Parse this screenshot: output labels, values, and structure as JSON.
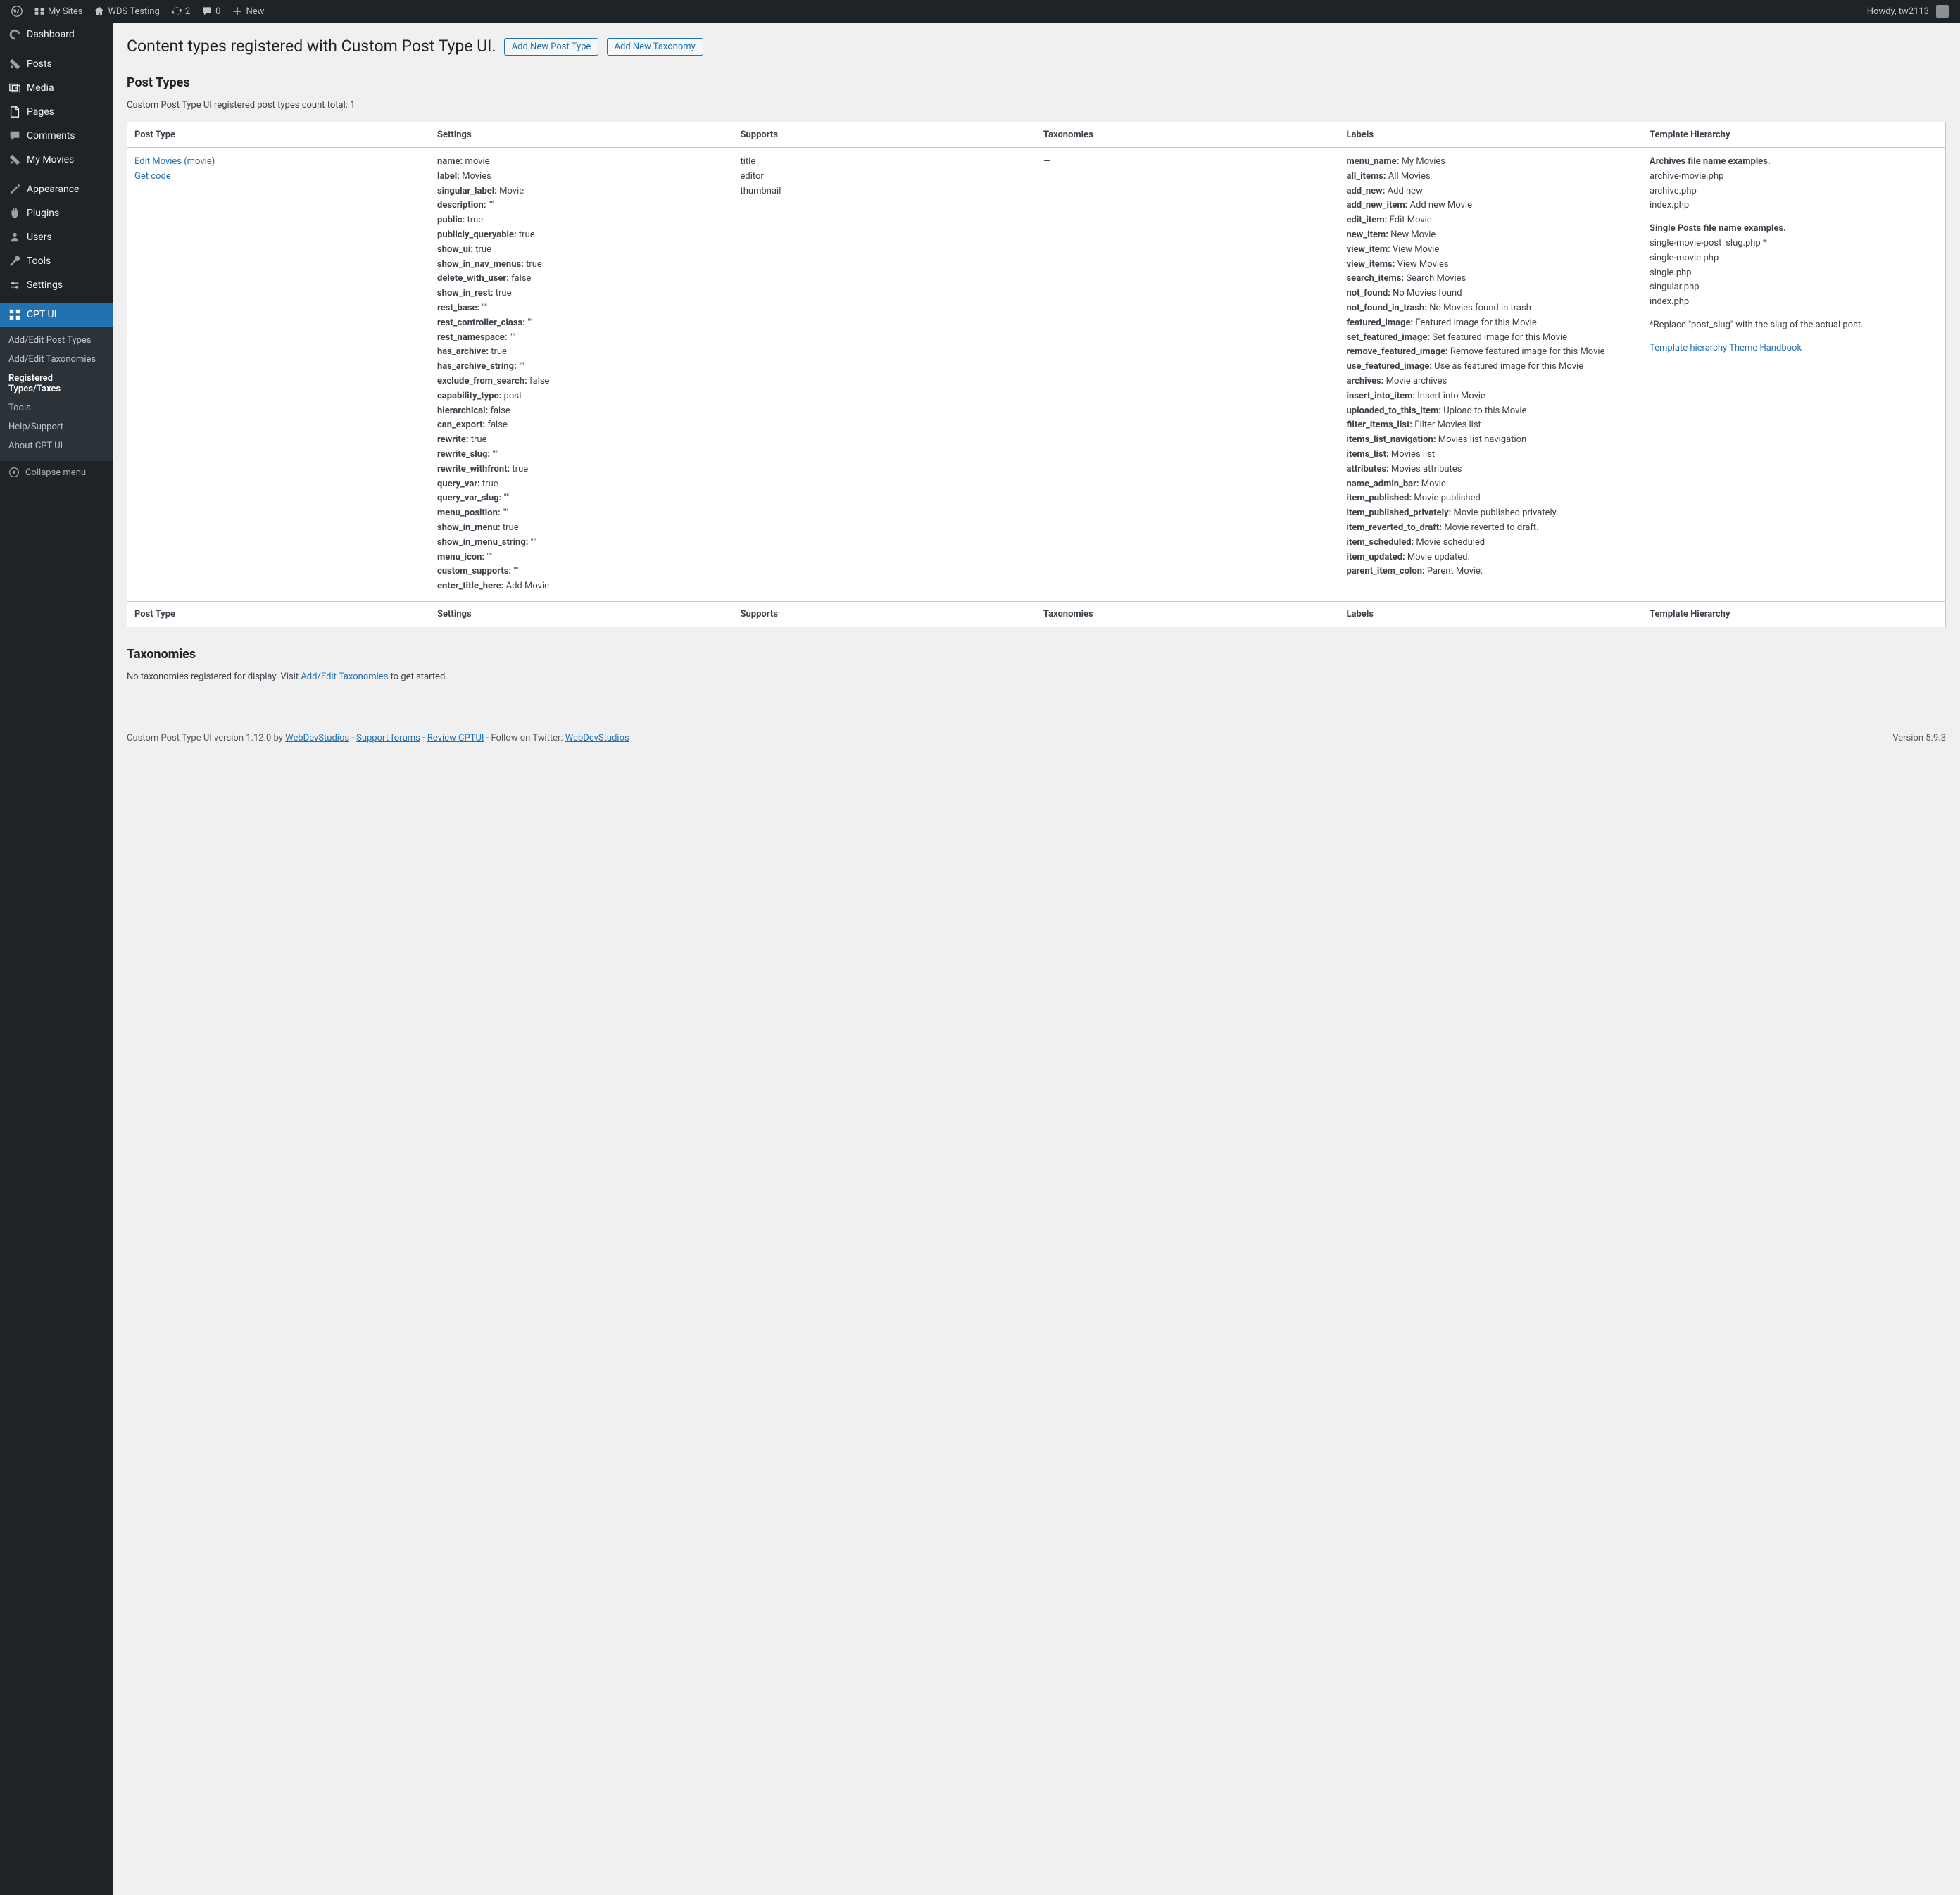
{
  "adminbar": {
    "my_sites": "My Sites",
    "site_name": "WDS Testing",
    "updates_count": "2",
    "comments_count": "0",
    "new": "New",
    "howdy": "Howdy, tw2113"
  },
  "sidebar": {
    "dashboard": "Dashboard",
    "posts": "Posts",
    "media": "Media",
    "pages": "Pages",
    "comments": "Comments",
    "my_movies": "My Movies",
    "appearance": "Appearance",
    "plugins": "Plugins",
    "users": "Users",
    "tools": "Tools",
    "settings": "Settings",
    "cpt_ui": "CPT UI",
    "sub": {
      "add_edit_post_types": "Add/Edit Post Types",
      "add_edit_taxonomies": "Add/Edit Taxonomies",
      "registered_types_taxes": "Registered Types/Taxes",
      "tools": "Tools",
      "help_support": "Help/Support",
      "about_cpt_ui": "About CPT UI"
    },
    "collapse": "Collapse menu"
  },
  "page": {
    "title": "Content types registered with Custom Post Type UI.",
    "add_post_type": "Add New Post Type",
    "add_taxonomy": "Add New Taxonomy",
    "post_types_heading": "Post Types",
    "count_text": "Custom Post Type UI registered post types count total: 1",
    "taxonomies_heading": "Taxonomies",
    "no_tax_prefix": "No taxonomies registered for display. Visit ",
    "no_tax_link": "Add/Edit Taxonomies",
    "no_tax_suffix": " to get started."
  },
  "table": {
    "columns": {
      "post_type": "Post Type",
      "settings": "Settings",
      "supports": "Supports",
      "taxonomies": "Taxonomies",
      "labels": "Labels",
      "template_hierarchy": "Template Hierarchy"
    },
    "row": {
      "edit_link": "Edit Movies (movie)",
      "get_code": "Get code",
      "taxonomies": "—",
      "supports": [
        "title",
        "editor",
        "thumbnail"
      ],
      "settings": [
        {
          "k": "name",
          "v": "movie"
        },
        {
          "k": "label",
          "v": "Movies"
        },
        {
          "k": "singular_label",
          "v": "Movie"
        },
        {
          "k": "description",
          "v": "\"\""
        },
        {
          "k": "public",
          "v": "true"
        },
        {
          "k": "publicly_queryable",
          "v": "true"
        },
        {
          "k": "show_ui",
          "v": "true"
        },
        {
          "k": "show_in_nav_menus",
          "v": "true"
        },
        {
          "k": "delete_with_user",
          "v": "false"
        },
        {
          "k": "show_in_rest",
          "v": "true"
        },
        {
          "k": "rest_base",
          "v": "\"\""
        },
        {
          "k": "rest_controller_class",
          "v": "\"\""
        },
        {
          "k": "rest_namespace",
          "v": "\"\""
        },
        {
          "k": "has_archive",
          "v": "true"
        },
        {
          "k": "has_archive_string",
          "v": "\"\""
        },
        {
          "k": "exclude_from_search",
          "v": "false"
        },
        {
          "k": "capability_type",
          "v": "post"
        },
        {
          "k": "hierarchical",
          "v": "false"
        },
        {
          "k": "can_export",
          "v": "false"
        },
        {
          "k": "rewrite",
          "v": "true"
        },
        {
          "k": "rewrite_slug",
          "v": "\"\""
        },
        {
          "k": "rewrite_withfront",
          "v": "true"
        },
        {
          "k": "query_var",
          "v": "true"
        },
        {
          "k": "query_var_slug",
          "v": "\"\""
        },
        {
          "k": "menu_position",
          "v": "\"\""
        },
        {
          "k": "show_in_menu",
          "v": "true"
        },
        {
          "k": "show_in_menu_string",
          "v": "\"\""
        },
        {
          "k": "menu_icon",
          "v": "\"\""
        },
        {
          "k": "custom_supports",
          "v": "\"\""
        },
        {
          "k": "enter_title_here",
          "v": "Add Movie"
        }
      ],
      "labels": [
        {
          "k": "menu_name",
          "v": "My Movies"
        },
        {
          "k": "all_items",
          "v": "All Movies"
        },
        {
          "k": "add_new",
          "v": "Add new"
        },
        {
          "k": "add_new_item",
          "v": "Add new Movie"
        },
        {
          "k": "edit_item",
          "v": "Edit Movie"
        },
        {
          "k": "new_item",
          "v": "New Movie"
        },
        {
          "k": "view_item",
          "v": "View Movie"
        },
        {
          "k": "view_items",
          "v": "View Movies"
        },
        {
          "k": "search_items",
          "v": "Search Movies"
        },
        {
          "k": "not_found",
          "v": "No Movies found"
        },
        {
          "k": "not_found_in_trash",
          "v": "No Movies found in trash"
        },
        {
          "k": "featured_image",
          "v": "Featured image for this Movie"
        },
        {
          "k": "set_featured_image",
          "v": "Set featured image for this Movie"
        },
        {
          "k": "remove_featured_image",
          "v": "Remove featured image for this Movie"
        },
        {
          "k": "use_featured_image",
          "v": "Use as featured image for this Movie"
        },
        {
          "k": "archives",
          "v": "Movie archives"
        },
        {
          "k": "insert_into_item",
          "v": "Insert into Movie"
        },
        {
          "k": "uploaded_to_this_item",
          "v": "Upload to this Movie"
        },
        {
          "k": "filter_items_list",
          "v": "Filter Movies list"
        },
        {
          "k": "items_list_navigation",
          "v": "Movies list navigation"
        },
        {
          "k": "items_list",
          "v": "Movies list"
        },
        {
          "k": "attributes",
          "v": "Movies attributes"
        },
        {
          "k": "name_admin_bar",
          "v": "Movie"
        },
        {
          "k": "item_published",
          "v": "Movie published"
        },
        {
          "k": "item_published_privately",
          "v": "Movie published privately."
        },
        {
          "k": "item_reverted_to_draft",
          "v": "Movie reverted to draft."
        },
        {
          "k": "item_scheduled",
          "v": "Movie scheduled"
        },
        {
          "k": "item_updated",
          "v": "Movie updated."
        },
        {
          "k": "parent_item_colon",
          "v": "Parent Movie:"
        }
      ],
      "template": {
        "archives_hdr": "Archives file name examples.",
        "archives": [
          "archive-movie.php",
          "archive.php",
          "index.php"
        ],
        "singles_hdr": "Single Posts file name examples.",
        "singles": [
          "single-movie-post_slug.php *",
          "single-movie.php",
          "single.php",
          "singular.php",
          "index.php"
        ],
        "note": "*Replace \"post_slug\" with the slug of the actual post.",
        "handbook_link": "Template hierarchy Theme Handbook"
      }
    }
  },
  "footer": {
    "left_prefix": "Custom Post Type UI version 1.12.0 by ",
    "wds": "WebDevStudios",
    "sep": " - ",
    "support": "Support forums",
    "review": "Review CPTUI",
    "twitter_prefix": " - Follow on Twitter: ",
    "twitter": "WebDevStudios",
    "version": "Version 5.9.3"
  }
}
